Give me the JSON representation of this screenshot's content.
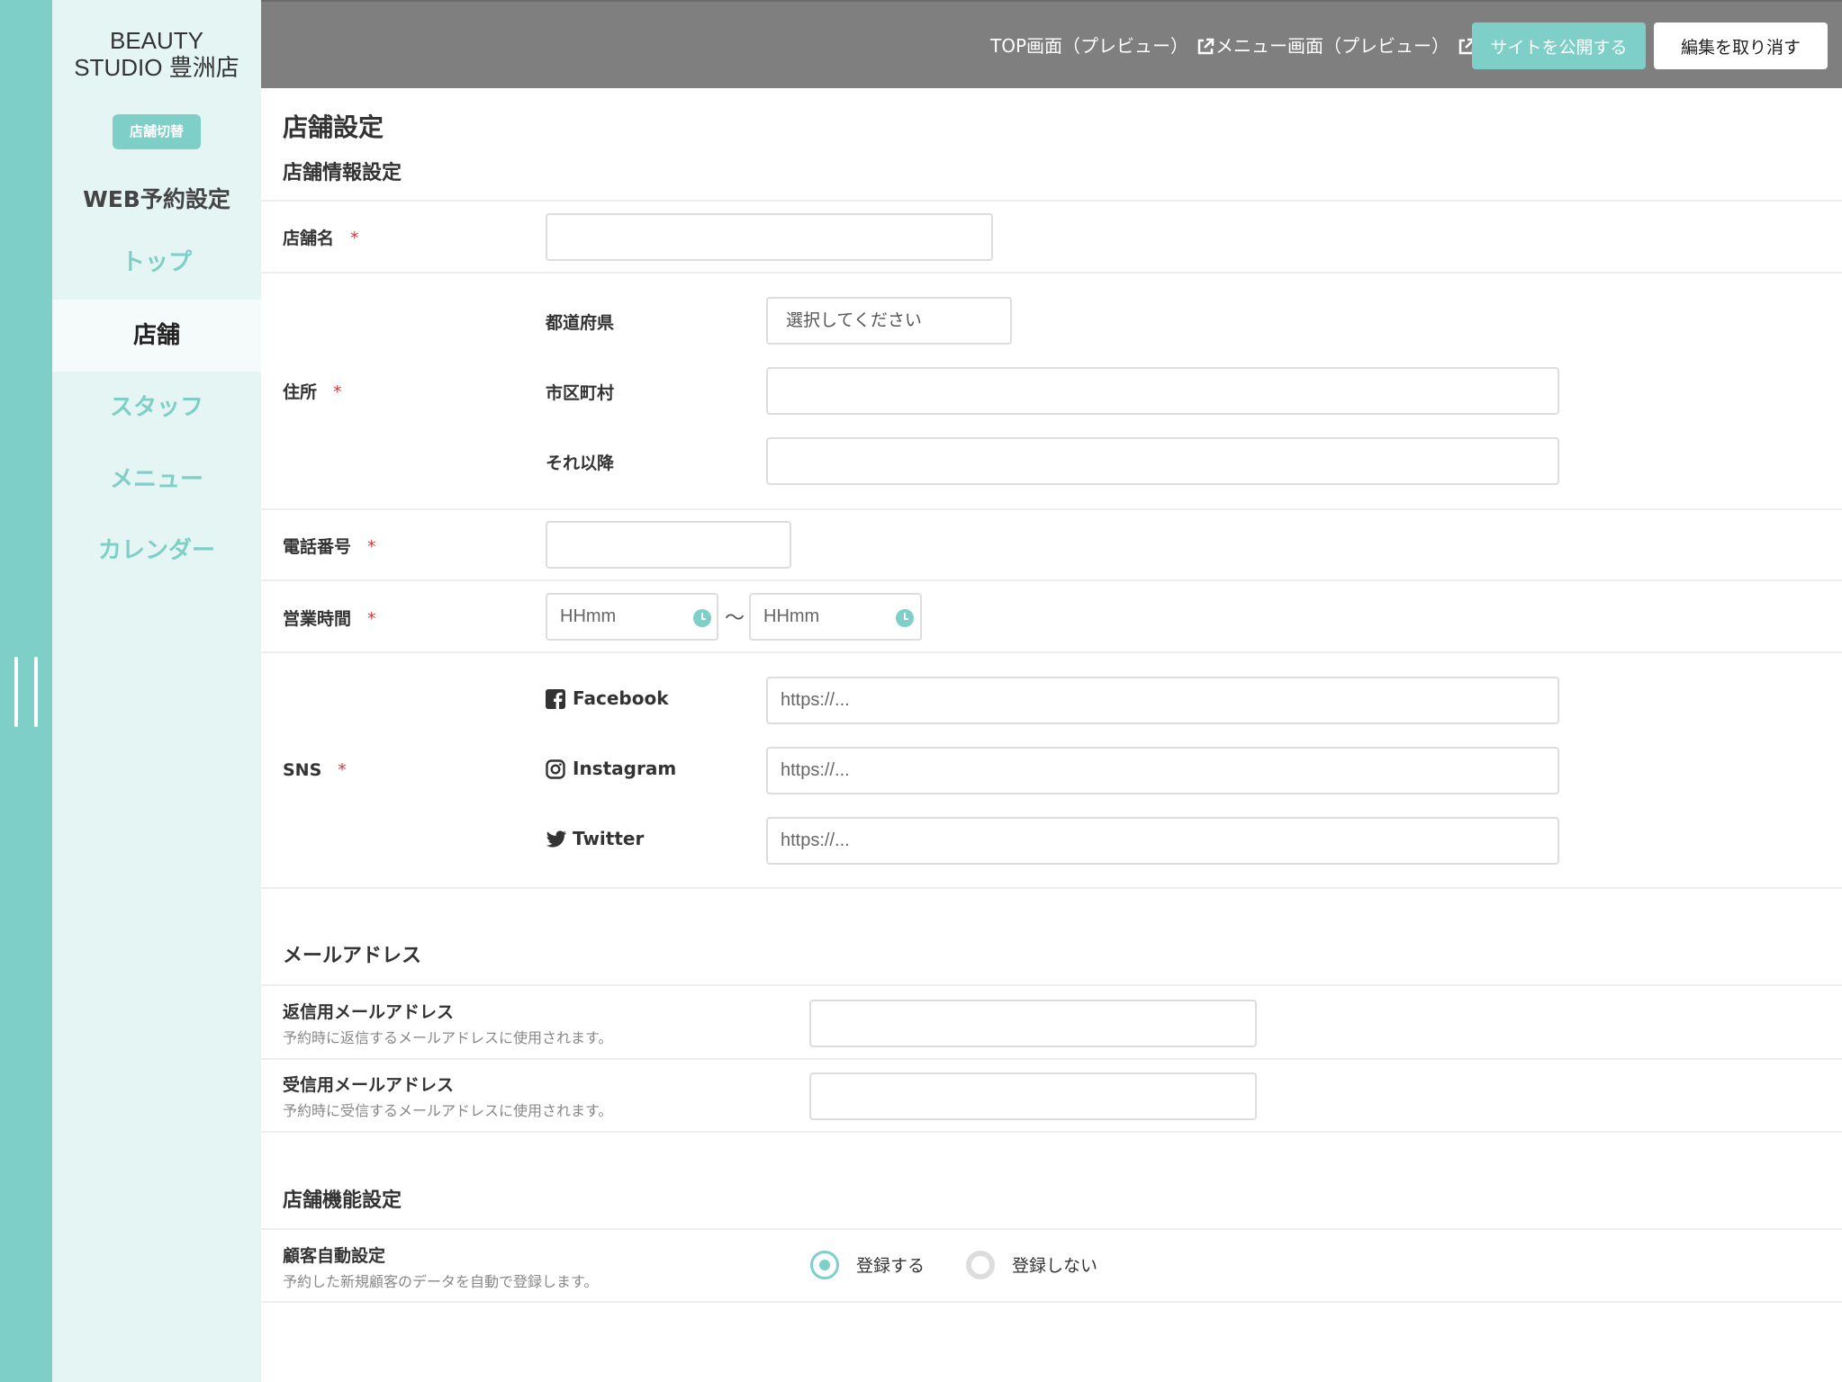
{
  "sidebar": {
    "store_name_line1": "BEAUTY",
    "store_name_line2": "STUDIO 豊洲店",
    "store_switch_label": "店舗切替",
    "section_title": "WEB予約設定",
    "nav": [
      {
        "label": "トップ",
        "active": false
      },
      {
        "label": "店舗",
        "active": true
      },
      {
        "label": "スタッフ",
        "active": false
      },
      {
        "label": "メニュー",
        "active": false
      },
      {
        "label": "カレンダー",
        "active": false
      }
    ]
  },
  "header": {
    "top_preview_label": "TOP画面（プレビュー）",
    "menu_preview_label": "メニュー画面（プレビュー）",
    "publish_label": "サイトを公開する",
    "cancel_label": "編集を取り消す"
  },
  "page": {
    "title": "店舗設定",
    "store_info_heading": "店舗情報設定",
    "store_name": {
      "label": "店舗名",
      "required_mark": "*",
      "value": ""
    },
    "address": {
      "label": "住所",
      "required_mark": "*",
      "prefecture_label": "都道府県",
      "prefecture_value": "選択してください",
      "city_label": "市区町村",
      "city_value": "",
      "rest_label": "それ以降",
      "rest_value": ""
    },
    "phone": {
      "label": "電話番号",
      "required_mark": "*",
      "value": ""
    },
    "hours": {
      "label": "営業時間",
      "required_mark": "*",
      "start_placeholder": "HHmm",
      "end_placeholder": "HHmm",
      "separator": "〜"
    },
    "sns": {
      "label": "SNS",
      "required_mark": "*",
      "items": [
        {
          "name": "Facebook",
          "icon": "facebook-icon",
          "placeholder": "https://..."
        },
        {
          "name": "Instagram",
          "icon": "instagram-icon",
          "placeholder": "https://..."
        },
        {
          "name": "Twitter",
          "icon": "twitter-icon",
          "placeholder": "https://..."
        }
      ]
    },
    "email_heading": "メールアドレス",
    "reply_email": {
      "label": "返信用メールアドレス",
      "description": "予約時に返信するメールアドレスに使用されます。",
      "value": ""
    },
    "receive_email": {
      "label": "受信用メールアドレス",
      "description": "予約時に受信するメールアドレスに使用されます。",
      "value": ""
    },
    "function_heading": "店舗機能設定",
    "auto_customer": {
      "label": "顧客自動設定",
      "description": "予約した新規顧客のデータを自動で登録します。",
      "option_on": "登録する",
      "option_off": "登録しない",
      "selected": "登録する"
    }
  },
  "colors": {
    "accent": "#7ecfc8",
    "header_bg": "#7f7f7f",
    "sidebar_bg": "#e5f5f3",
    "required": "#d23a3a"
  }
}
